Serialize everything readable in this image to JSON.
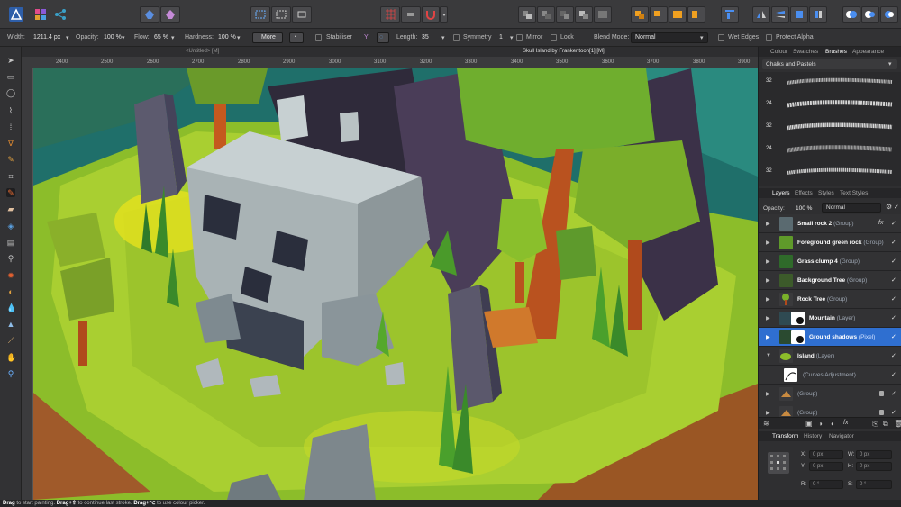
{
  "document": {
    "untitled_tab": "<Untitled> [M]",
    "title": "Skull Island by Frankentoon[1] [M]"
  },
  "context_toolbar": {
    "width_label": "Width:",
    "width_value": "1211.4 px",
    "opacity_label": "Opacity:",
    "opacity_value": "100 %",
    "flow_label": "Flow:",
    "flow_value": "65 %",
    "hardness_label": "Hardness:",
    "hardness_value": "100 %",
    "more_button": "More",
    "stabiliser_label": "Stabiliser",
    "length_label": "Length:",
    "length_value": "35",
    "symmetry_label": "Symmetry",
    "symmetry_value": "1",
    "mirror_label": "Mirror",
    "lock_label": "Lock",
    "blend_mode_label": "Blend Mode:",
    "blend_mode_value": "Normal",
    "wet_edges_label": "Wet Edges",
    "protect_alpha_label": "Protect Alpha"
  },
  "ruler": {
    "ticks": [
      "2400",
      "2500",
      "2600",
      "2700",
      "2800",
      "2900",
      "3000",
      "3100",
      "3200",
      "3300",
      "3400",
      "3500",
      "3600",
      "3700",
      "3800",
      "3900"
    ]
  },
  "panels": {
    "top_tabs": [
      "Colour",
      "Swatches",
      "Brushes",
      "Appearance"
    ],
    "brush_category": "Chalks and Pastels",
    "brush_sizes": [
      "32",
      "24",
      "32",
      "24",
      "32"
    ],
    "layer_tabs": [
      "Layers",
      "Effects",
      "Styles",
      "Text Styles"
    ],
    "opacity_label": "Opacity:",
    "opacity_value": "100 %",
    "blend_value": "Normal",
    "layers": [
      {
        "name": "Small rock 2",
        "type": "(Group)"
      },
      {
        "name": "Foreground green rock",
        "type": "(Group)"
      },
      {
        "name": "Grass clump 4",
        "type": "(Group)"
      },
      {
        "name": "Background Tree",
        "type": "(Group)"
      },
      {
        "name": "Rock Tree",
        "type": "(Group)"
      },
      {
        "name": "Mountain",
        "type": "(Layer)"
      },
      {
        "name": "Ground shadows",
        "type": "(Pixel)"
      },
      {
        "name": "Island",
        "type": "(Layer)"
      },
      {
        "name": "",
        "type": "(Curves Adjustment)"
      },
      {
        "name": "",
        "type": "(Group)"
      },
      {
        "name": "",
        "type": "(Group)"
      }
    ],
    "fx_symbol": "fx",
    "check_symbol": "✓",
    "bottom_tabs": [
      "Transform",
      "History",
      "Navigator"
    ],
    "transform": {
      "x_label": "X:",
      "x_value": "0 px",
      "y_label": "Y:",
      "y_value": "0 px",
      "w_label": "W:",
      "w_value": "0 px",
      "h_label": "H:",
      "h_value": "0 px",
      "r_label": "R:",
      "r_value": "0 °",
      "s_label": "S:",
      "s_value": "0 °"
    }
  },
  "status": {
    "drag1": "Drag",
    "text1": "to start painting.",
    "drag2": "Drag+⇧",
    "text2": "to continue last stroke.",
    "drag3": "Drag+⌥",
    "text3": "to use colour picker."
  },
  "colors": {
    "accent": "#2f6fd0",
    "toolbar": "#3a3a3c",
    "panel": "#2f2f31"
  }
}
